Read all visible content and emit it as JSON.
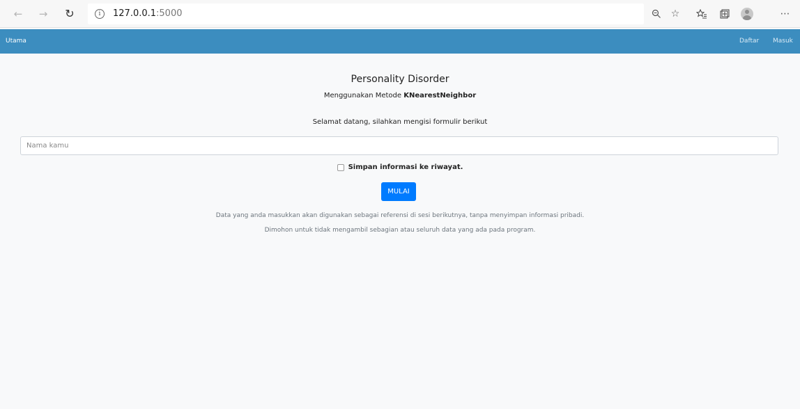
{
  "browser": {
    "back_icon": "arrow-left-icon",
    "forward_icon": "arrow-right-icon",
    "reload_icon": "reload-icon",
    "info_icon": "info-icon",
    "url_host": "127.0.0.1",
    "url_port": ":5000",
    "toolbar_icons": [
      "zoom-icon",
      "star-icon",
      "favorites-icon",
      "collections-icon",
      "profile-icon",
      "more-icon"
    ]
  },
  "navbar": {
    "brand": "Utama",
    "links": [
      "Daftar",
      "Masuk"
    ],
    "color": "#3c8dbf"
  },
  "main": {
    "title": "Personality Disorder",
    "subtitle_prefix": "Menggunakan Metode ",
    "subtitle_method": "KNearestNeighbor",
    "welcome": "Selamat datang, silahkan mengisi formulir berikut",
    "name_placeholder": "Nama kamu",
    "name_value": "",
    "checkbox_label": "Simpan informasi ke riwayat.",
    "checkbox_checked": false,
    "start_button": "MULAI",
    "button_color": "#007bff",
    "note_line1": "Data yang anda masukkan akan digunakan sebagai referensi di sesi berikutnya, tanpa menyimpan informasi pribadi.",
    "note_line2": "Dimohon untuk tidak mengambil sebagian atau seluruh data yang ada pada program."
  }
}
